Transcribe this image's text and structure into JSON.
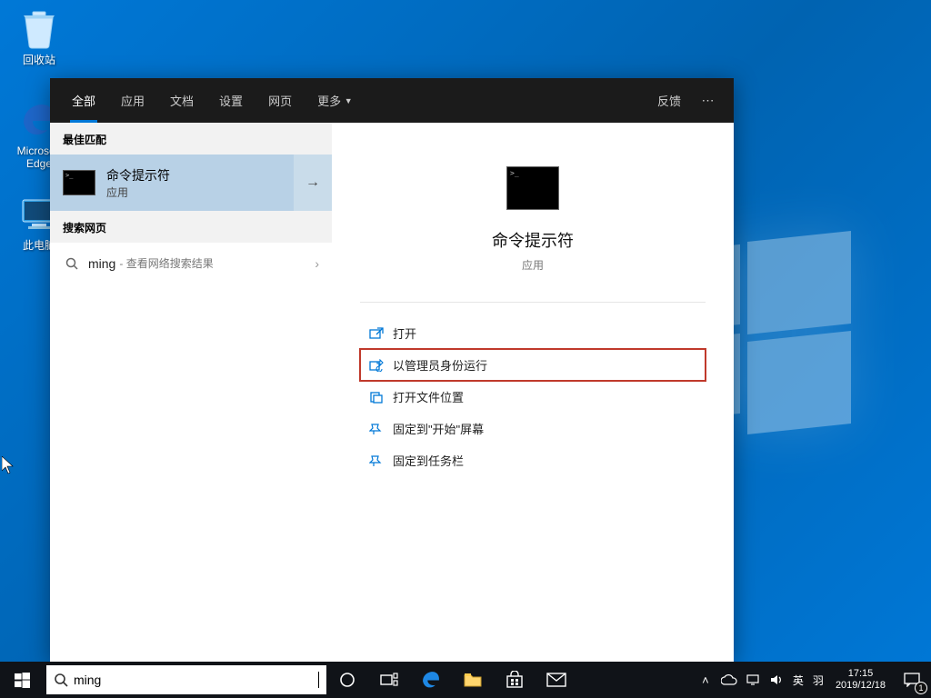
{
  "desktop": {
    "icons": [
      {
        "name": "recycle-bin",
        "label": "回收站"
      },
      {
        "name": "edge",
        "label": "Microsoft Edge"
      },
      {
        "name": "this-pc",
        "label": "此电脑"
      }
    ]
  },
  "search_panel": {
    "tabs": [
      "全部",
      "应用",
      "文档",
      "设置",
      "网页",
      "更多"
    ],
    "feedback": "反馈",
    "best_match_header": "最佳匹配",
    "match": {
      "title": "命令提示符",
      "subtitle": "应用"
    },
    "web_header": "搜索网页",
    "web_query": "ming",
    "web_hint": "- 查看网络搜索结果",
    "preview": {
      "title": "命令提示符",
      "subtitle": "应用"
    },
    "actions": [
      {
        "icon": "open-icon",
        "label": "打开",
        "highlighted": false
      },
      {
        "icon": "admin-run-icon",
        "label": "以管理员身份运行",
        "highlighted": true
      },
      {
        "icon": "folder-open-icon",
        "label": "打开文件位置",
        "highlighted": false
      },
      {
        "icon": "pin-start-icon",
        "label": "固定到\"开始\"屏幕",
        "highlighted": false
      },
      {
        "icon": "pin-taskbar-icon",
        "label": "固定到任务栏",
        "highlighted": false
      }
    ]
  },
  "taskbar": {
    "search_value": "ming",
    "tray": {
      "ime1": "英",
      "ime2": "羽",
      "time": "17:15",
      "date": "2019/12/18",
      "notif_count": "1"
    }
  }
}
